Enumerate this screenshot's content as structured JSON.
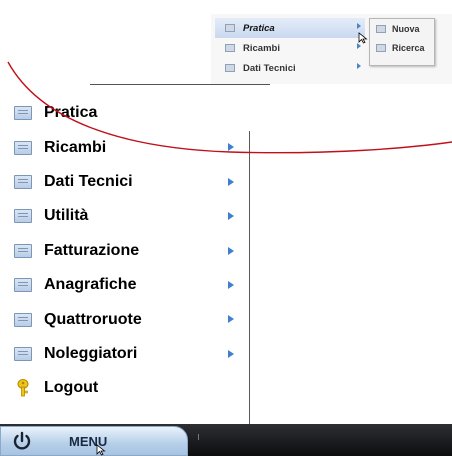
{
  "inset": {
    "items": [
      {
        "label": "Pratica",
        "has_arrow": true,
        "active": true
      },
      {
        "label": "Ricambi",
        "has_arrow": true,
        "active": false
      },
      {
        "label": "Dati Tecnici",
        "has_arrow": true,
        "active": false
      }
    ],
    "submenu": [
      {
        "label": "Nuova"
      },
      {
        "label": "Ricerca"
      }
    ]
  },
  "menu": {
    "items": [
      {
        "label": "Pratica",
        "icon": "menu-item-icon",
        "has_arrow": false
      },
      {
        "label": "Ricambi",
        "icon": "menu-item-icon",
        "has_arrow": true
      },
      {
        "label": "Dati Tecnici",
        "icon": "menu-item-icon",
        "has_arrow": true
      },
      {
        "label": "Utilità",
        "icon": "menu-item-icon",
        "has_arrow": true
      },
      {
        "label": "Fatturazione",
        "icon": "menu-item-icon",
        "has_arrow": true
      },
      {
        "label": "Anagrafiche",
        "icon": "menu-item-icon",
        "has_arrow": true
      },
      {
        "label": "Quattroruote",
        "icon": "menu-item-icon",
        "has_arrow": true
      },
      {
        "label": "Noleggiatori",
        "icon": "menu-item-icon",
        "has_arrow": true
      },
      {
        "label": "Logout",
        "icon": "key-icon",
        "has_arrow": false
      }
    ]
  },
  "taskbar": {
    "start_label": "MENU"
  },
  "colors": {
    "arrow": "#3d80cf",
    "annotation": "#c0101a",
    "taskbar": "#16171a"
  }
}
